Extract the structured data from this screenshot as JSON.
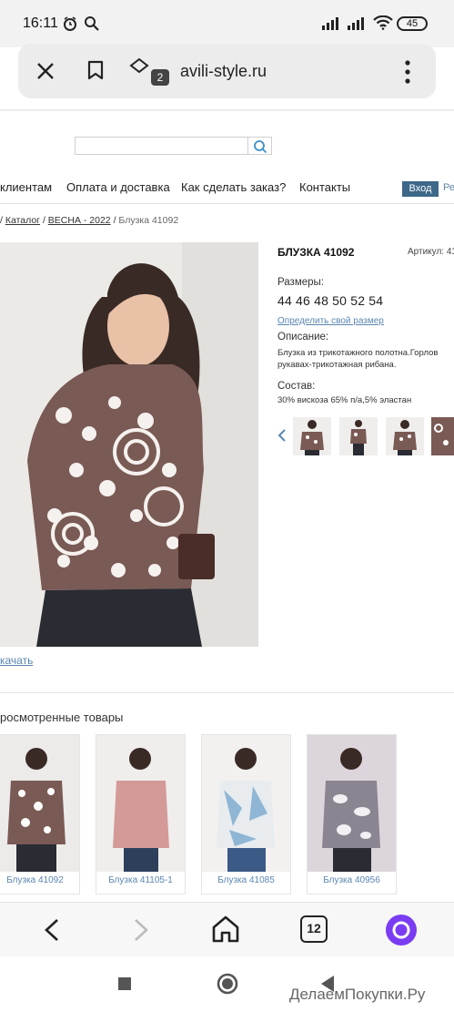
{
  "status": {
    "time": "16:11",
    "battery": "45"
  },
  "browser": {
    "url": "avili-style.ru",
    "tab_badge": "2"
  },
  "nav": {
    "items": [
      "клиентам",
      "Оплата и доставка",
      "Как сделать заказ?",
      "Контакты"
    ],
    "login": "Вход",
    "register": "Ре"
  },
  "breadcrumb": {
    "sep1": "/",
    "catalog": "Каталог",
    "sep2": "/",
    "season": "ВЕСНА - 2022",
    "sep3": "/",
    "current": "Блузка 41092"
  },
  "product": {
    "title": "БЛУЗКА 41092",
    "article": "Артикул: 41",
    "sizes_label": "Размеры:",
    "sizes": "44 46 48 50 52 54",
    "size_link": "Определить свой размер",
    "description_label": "Описание:",
    "description_line1": "Блузка из трикотажного полотна.Горлов",
    "description_line2": "рукавах-трикотажная рибана.",
    "composition_label": "Состав:",
    "composition": "30% вискоза 65% п/а,5% эластан",
    "download": "качать"
  },
  "viewed": {
    "title": "росмотренные товары",
    "items": [
      {
        "label": "Блузка 41092"
      },
      {
        "label": "Блузка 41105-1"
      },
      {
        "label": "Блузка 41085"
      },
      {
        "label": "Блузка 40956"
      }
    ]
  },
  "bottom": {
    "tabs_count": "12"
  },
  "watermark": "ДелаемПокупки.Ру",
  "colors": {
    "accent": "#3d6888",
    "link": "#5b86b0",
    "print": "#7a5a55"
  }
}
